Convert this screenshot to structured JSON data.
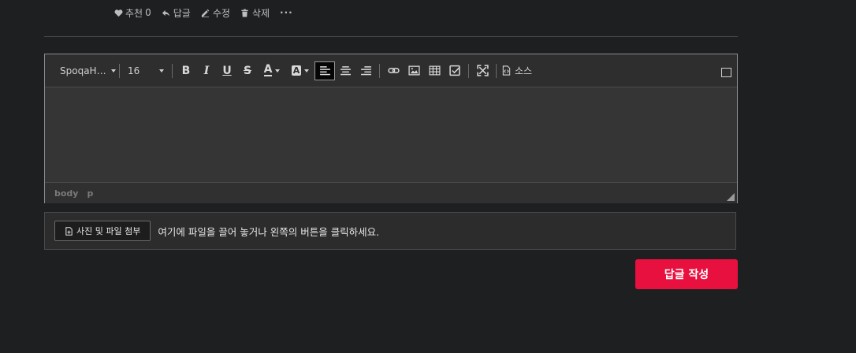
{
  "post_actions": {
    "recommend_label": "추천",
    "recommend_count": "0",
    "reply_label": "답글",
    "edit_label": "수정",
    "delete_label": "삭제",
    "more_label": "···"
  },
  "editor": {
    "font_family": "SpoqaH…",
    "font_size": "16",
    "source_label": "소스",
    "status_path": [
      "body",
      "p"
    ],
    "toolbar_icons": [
      "bold-icon",
      "italic-icon",
      "underline-icon",
      "strikethrough-icon",
      "font-color-icon",
      "background-color-icon",
      "align-left-icon",
      "align-center-icon",
      "align-right-icon",
      "link-icon",
      "image-icon",
      "table-icon",
      "checkbox-icon",
      "fullscreen-icon",
      "source-icon"
    ]
  },
  "attachment": {
    "button_label": "사진 및 파일 첨부",
    "hint": "여기에 파일을 끌어 놓거나 왼쪽의 버튼을 클릭하세요."
  },
  "submit": {
    "label": "답글 작성",
    "color": "#e8103f"
  },
  "colors": {
    "background": "#1e1f21",
    "editor_bg": "#353535",
    "accent": "#e8103f"
  }
}
